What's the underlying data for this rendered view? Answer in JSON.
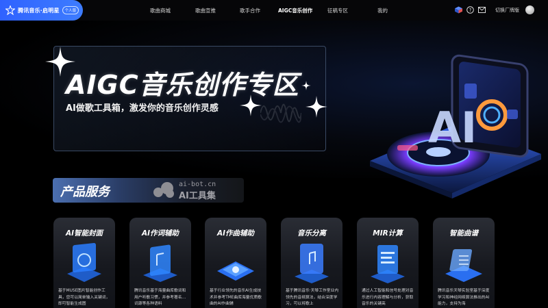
{
  "brand": {
    "name": "腾讯音乐·启明星",
    "badge": "个人版",
    "accent": "#2f62ff"
  },
  "nav": {
    "items": [
      "歌曲商城",
      "歌曲宣推",
      "歌手合作",
      "AIGC音乐创作",
      "征稿专区",
      "我的"
    ],
    "active": "AIGC音乐创作",
    "switch_label": "切换厂牌版"
  },
  "hero": {
    "title": "AIGC音乐创作专区",
    "subtitle": "AI做歌工具箱，激发你的音乐创作灵感"
  },
  "section": {
    "title": "产品服务"
  },
  "watermark": {
    "line1": "ai-bot.cn",
    "line2": "AI工具集"
  },
  "cards": [
    {
      "title": "AI智能封面",
      "desc": "基于MUSE图片智能创作工具，您可以简单输入关键词，即可智能生成图"
    },
    {
      "title": "AI作词辅助",
      "desc": "腾讯音乐基于海量曲库歌词和用户听歌习惯，并参考著名…词源等各种语料"
    },
    {
      "title": "AI作曲辅助",
      "desc": "基于行业领先的音乐AI生成技术并参考TME曲库海量优质歌曲的AI作曲辅"
    },
    {
      "title": "音乐分离",
      "desc": "基于腾讯音乐·天琴工作室业内领先的音频算法，结合深度学习，可以将歌上"
    },
    {
      "title": "MIR计算",
      "desc": "通过人工智能和信号处理对音乐进行内容理解与分析，获取音乐的关键高"
    },
    {
      "title": "智能曲谱",
      "desc": "腾讯音乐天琴实验室基于深度学习和神经网络算法推出的AI能力，支持为海"
    }
  ]
}
